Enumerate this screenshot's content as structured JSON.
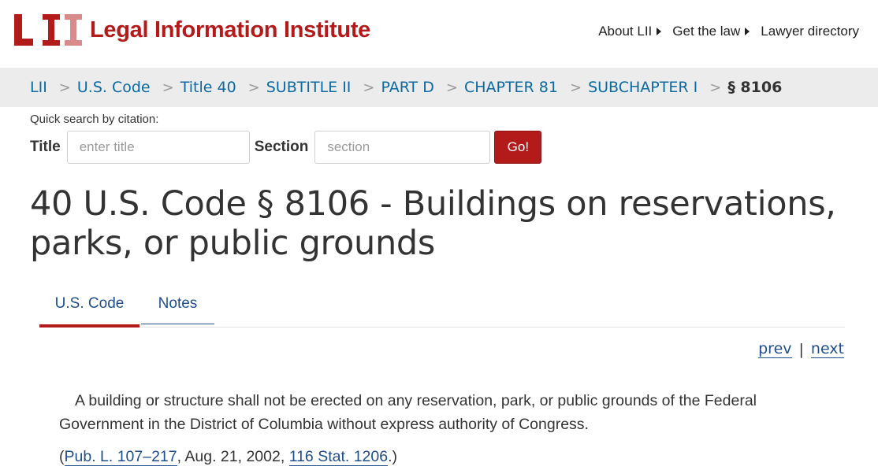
{
  "header": {
    "logo_text": "Legal Information Institute",
    "logo_mark_text": "LII",
    "brand_color": "#b31b1b",
    "nav": [
      {
        "label": "About LII",
        "icon": "caret-right-icon"
      },
      {
        "label": "Get the law",
        "icon": "caret-right-icon"
      },
      {
        "label": "Lawyer directory"
      }
    ]
  },
  "breadcrumb": {
    "separator": ">",
    "items": [
      "LII",
      "U.S. Code",
      "Title 40",
      "SUBTITLE II",
      "PART D",
      "CHAPTER 81",
      "SUBCHAPTER I"
    ],
    "current": "§ 8106"
  },
  "quick_search": {
    "label": "Quick search by citation:",
    "title_label": "Title",
    "title_placeholder": "enter title",
    "section_label": "Section",
    "section_placeholder": "section",
    "go_label": "Go!"
  },
  "page": {
    "title": "40 U.S. Code § 8106 - Buildings on reservations, parks, or public grounds"
  },
  "tabs": [
    {
      "label": "U.S. Code",
      "active": true
    },
    {
      "label": "Notes",
      "active": false
    }
  ],
  "pager": {
    "prev": "prev",
    "separator": "|",
    "next": "next"
  },
  "content": {
    "text": "A building or structure shall not be erected on any reservation, park, or public grounds of the Federal Government in the District of Columbia without express authority of Congress.",
    "citation_open": "(",
    "citation_link_1": "Pub. L. 107–217",
    "citation_mid": ", Aug. 21, 2002, ",
    "citation_link_2": "116 Stat. 1206",
    "citation_close": ".)"
  }
}
